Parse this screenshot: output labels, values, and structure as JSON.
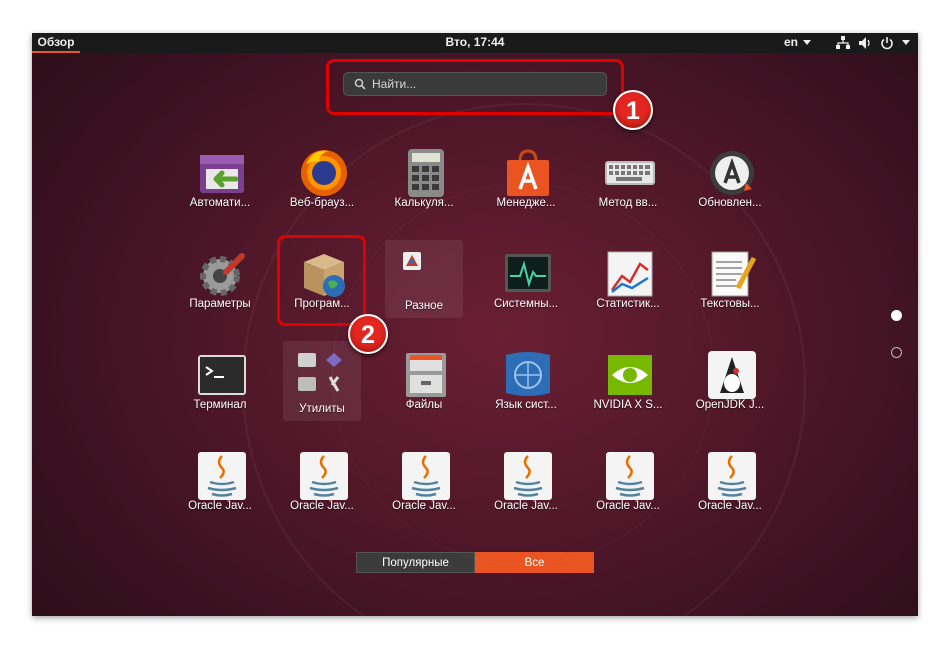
{
  "topbar": {
    "overview": "Обзор",
    "clock": "Вто, 17:44",
    "lang": "en",
    "icons": [
      "network-icon",
      "volume-icon",
      "power-icon",
      "chevron-down-icon"
    ]
  },
  "search": {
    "placeholder": "Найти..."
  },
  "annotations": {
    "badge1": "1",
    "badge2": "2",
    "color": "#e00000"
  },
  "apps": [
    {
      "label": "Автомати...",
      "icon": "automation-icon"
    },
    {
      "label": "Веб-брауз...",
      "icon": "firefox-icon"
    },
    {
      "label": "Калькуля...",
      "icon": "calculator-icon"
    },
    {
      "label": "Менедже...",
      "icon": "software-store-icon"
    },
    {
      "label": "Метод вв...",
      "icon": "keyboard-icon"
    },
    {
      "label": "Обновлен...",
      "icon": "software-updater-icon"
    },
    {
      "label": "Параметры",
      "icon": "settings-icon"
    },
    {
      "label": "Програм...",
      "icon": "software-package-icon"
    },
    {
      "label": "Разное",
      "icon": "misc-folder-icon"
    },
    {
      "label": "Системны...",
      "icon": "system-monitor-icon"
    },
    {
      "label": "Статистик...",
      "icon": "statistics-icon"
    },
    {
      "label": "Текстовы...",
      "icon": "text-editor-icon"
    },
    {
      "label": "Терминал",
      "icon": "terminal-icon"
    },
    {
      "label": "Утилиты",
      "icon": "utilities-folder-icon"
    },
    {
      "label": "Файлы",
      "icon": "files-icon"
    },
    {
      "label": "Язык сист...",
      "icon": "language-icon"
    },
    {
      "label": "NVIDIA X S...",
      "icon": "nvidia-icon"
    },
    {
      "label": "OpenJDK J...",
      "icon": "openjdk-icon"
    },
    {
      "label": "Oracle Jav...",
      "icon": "java-icon"
    },
    {
      "label": "Oracle Jav...",
      "icon": "java-icon"
    },
    {
      "label": "Oracle Jav...",
      "icon": "java-icon"
    },
    {
      "label": "Oracle Jav...",
      "icon": "java-icon"
    },
    {
      "label": "Oracle Jav...",
      "icon": "java-icon"
    },
    {
      "label": "Oracle Jav...",
      "icon": "java-icon"
    }
  ],
  "pages": {
    "count": 2,
    "current": 1
  },
  "tabs": {
    "popular": "Популярные",
    "all": "Все",
    "active": "all"
  },
  "colors": {
    "accent": "#e95420",
    "topbar": "#1a1a1a",
    "background": "#4f1729"
  }
}
